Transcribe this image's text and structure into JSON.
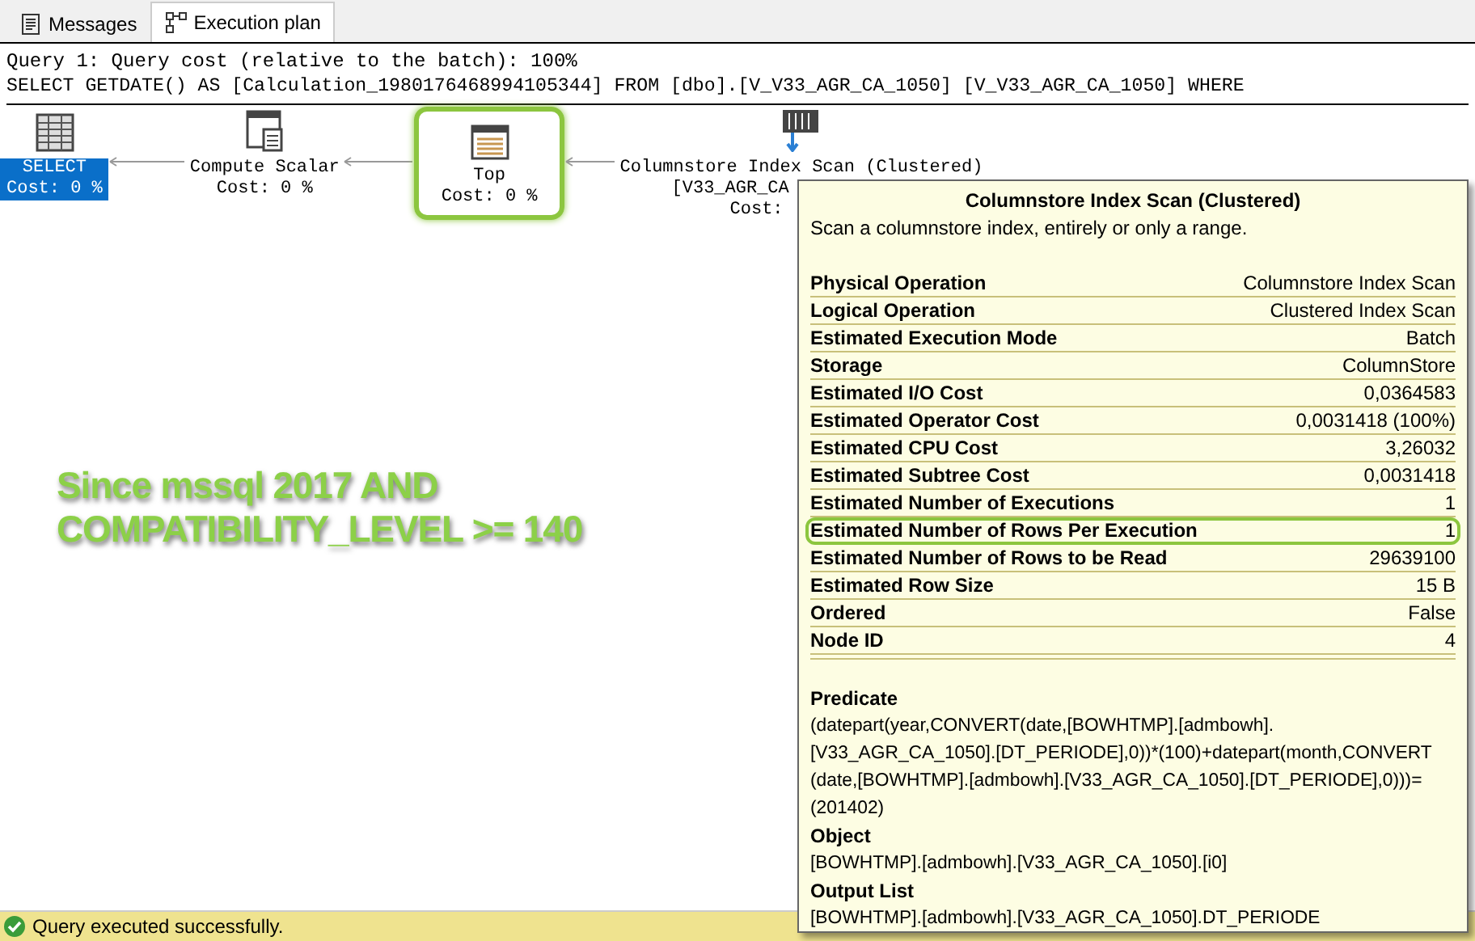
{
  "tabs": [
    {
      "label": "Messages",
      "kind": "messages",
      "selected": false
    },
    {
      "label": "Execution plan",
      "kind": "plan",
      "selected": true
    }
  ],
  "query_header": "Query 1: Query cost (relative to the batch): 100%",
  "query_text": "SELECT GETDATE() AS [Calculation_1980176468994105344] FROM [dbo].[V_V33_AGR_CA_1050] [V_V33_AGR_CA_1050] WHERE",
  "plan_nodes": [
    {
      "kind": "select",
      "lines": [
        "SELECT",
        "Cost: 0 %"
      ],
      "selected": true,
      "highlighted": false
    },
    {
      "kind": "compute",
      "lines": [
        "Compute Scalar",
        "Cost: 0 %"
      ],
      "selected": false,
      "highlighted": false
    },
    {
      "kind": "top",
      "lines": [
        "Top",
        "Cost: 0 %"
      ],
      "selected": false,
      "highlighted": true
    },
    {
      "kind": "columnstore",
      "lines": [
        "Columnstore Index Scan (Clustered)",
        "[V33_AGR_CA",
        "Cost:"
      ],
      "selected": false,
      "highlighted": false
    }
  ],
  "annotation": [
    "Since mssql 2017 AND",
    "COMPATIBILITY_LEVEL >= 140"
  ],
  "tooltip": {
    "title": "Columnstore Index Scan (Clustered)",
    "description": "Scan a columnstore index, entirely or only a range.",
    "properties": [
      {
        "name": "Physical Operation",
        "value": "Columnstore Index Scan",
        "highlighted": false
      },
      {
        "name": "Logical Operation",
        "value": "Clustered Index Scan",
        "highlighted": false
      },
      {
        "name": "Estimated Execution Mode",
        "value": "Batch",
        "highlighted": false
      },
      {
        "name": "Storage",
        "value": "ColumnStore",
        "highlighted": false
      },
      {
        "name": "Estimated I/O Cost",
        "value": "0,0364583",
        "highlighted": false
      },
      {
        "name": "Estimated Operator Cost",
        "value": "0,0031418 (100%)",
        "highlighted": false
      },
      {
        "name": "Estimated CPU Cost",
        "value": "3,26032",
        "highlighted": false
      },
      {
        "name": "Estimated Subtree Cost",
        "value": "0,0031418",
        "highlighted": false
      },
      {
        "name": "Estimated Number of Executions",
        "value": "1",
        "highlighted": false
      },
      {
        "name": "Estimated Number of Rows Per Execution",
        "value": "1",
        "highlighted": true
      },
      {
        "name": "Estimated Number of Rows to be Read",
        "value": "29639100",
        "highlighted": false
      },
      {
        "name": "Estimated Row Size",
        "value": "15 B",
        "highlighted": false
      },
      {
        "name": "Ordered",
        "value": "False",
        "highlighted": false
      },
      {
        "name": "Node ID",
        "value": "4",
        "highlighted": false
      }
    ],
    "sections": [
      {
        "heading": "Predicate",
        "lines": [
          "(datepart(year,CONVERT(date,[BOWHTMP].[admbowh].",
          "[V33_AGR_CA_1050].[DT_PERIODE],0))*(100)+datepart(month,CONVERT",
          "(date,[BOWHTMP].[admbowh].[V33_AGR_CA_1050].[DT_PERIODE],0)))=",
          "(201402)"
        ]
      },
      {
        "heading": "Object",
        "lines": [
          "[BOWHTMP].[admbowh].[V33_AGR_CA_1050].[i0]"
        ]
      },
      {
        "heading": "Output List",
        "lines": [
          "[BOWHTMP].[admbowh].[V33_AGR_CA_1050].DT_PERIODE"
        ]
      }
    ]
  },
  "status_bar": {
    "message": "Query executed successfully."
  }
}
